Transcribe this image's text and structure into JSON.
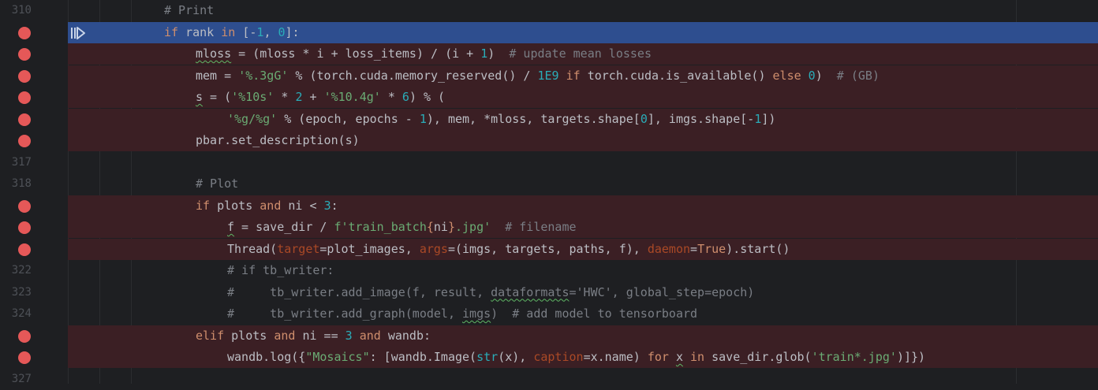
{
  "colors": {
    "background": "#1e1f22",
    "breakpoint_line": "#3b1f24",
    "current_line": "#2e4e8f",
    "breakpoint_dot": "#e55858",
    "keyword": "#cf8e6d",
    "number": "#2aacb8",
    "string": "#6aab73",
    "comment": "#7a7e85",
    "param": "#aa4926"
  },
  "icons": {
    "breakpoint": "breakpoint-icon",
    "execution": "execution-point-icon"
  },
  "lines": [
    {
      "num": "310",
      "indent": 0,
      "tokens": [
        {
          "t": "# Print",
          "c": "com"
        }
      ]
    },
    {
      "num": "",
      "bp": true,
      "current": true,
      "indent": 0,
      "tokens": [
        {
          "t": "if",
          "c": "kw"
        },
        {
          "t": " rank "
        },
        {
          "t": "in",
          "c": "kw"
        },
        {
          "t": " [-"
        },
        {
          "t": "1",
          "c": "num"
        },
        {
          "t": ", "
        },
        {
          "t": "0",
          "c": "num"
        },
        {
          "t": "]:"
        }
      ]
    },
    {
      "num": "",
      "bp": true,
      "indent": 1,
      "tokens": [
        {
          "t": "mloss",
          "w": true
        },
        {
          "t": " = (mloss * i + loss_items) / (i + "
        },
        {
          "t": "1",
          "c": "num"
        },
        {
          "t": ")  "
        },
        {
          "t": "# update mean losses",
          "c": "com"
        }
      ]
    },
    {
      "num": "",
      "bp": true,
      "indent": 1,
      "tokens": [
        {
          "t": "mem = "
        },
        {
          "t": "'%.3gG'",
          "c": "str"
        },
        {
          "t": " % (torch.cuda.memory_reserved() / "
        },
        {
          "t": "1E9",
          "c": "num"
        },
        {
          "t": " "
        },
        {
          "t": "if",
          "c": "kw"
        },
        {
          "t": " torch.cuda.is_available() "
        },
        {
          "t": "else",
          "c": "kw"
        },
        {
          "t": " "
        },
        {
          "t": "0",
          "c": "num"
        },
        {
          "t": ")  "
        },
        {
          "t": "# (GB)",
          "c": "com"
        }
      ]
    },
    {
      "num": "",
      "bp": true,
      "indent": 1,
      "tokens": [
        {
          "t": "s",
          "w": true
        },
        {
          "t": " = ("
        },
        {
          "t": "'%10s'",
          "c": "str"
        },
        {
          "t": " * "
        },
        {
          "t": "2",
          "c": "num"
        },
        {
          "t": " + "
        },
        {
          "t": "'%10.4g'",
          "c": "str"
        },
        {
          "t": " * "
        },
        {
          "t": "6",
          "c": "num"
        },
        {
          "t": ") % ("
        }
      ]
    },
    {
      "num": "",
      "bp": true,
      "indent": 2,
      "tokens": [
        {
          "t": "'%g/%g'",
          "c": "str"
        },
        {
          "t": " % (epoch, epochs - "
        },
        {
          "t": "1",
          "c": "num"
        },
        {
          "t": "), mem, *mloss, targets.shape["
        },
        {
          "t": "0",
          "c": "num"
        },
        {
          "t": "], imgs.shape[-"
        },
        {
          "t": "1",
          "c": "num"
        },
        {
          "t": "])"
        }
      ]
    },
    {
      "num": "",
      "bp": true,
      "indent": 1,
      "tokens": [
        {
          "t": "pbar.set_description(s)"
        }
      ]
    },
    {
      "num": "317",
      "indent": 0,
      "tokens": []
    },
    {
      "num": "318",
      "indent": 1,
      "tokens": [
        {
          "t": "# Plot",
          "c": "com"
        }
      ]
    },
    {
      "num": "",
      "bp": true,
      "indent": 1,
      "tokens": [
        {
          "t": "if",
          "c": "kw"
        },
        {
          "t": " plots "
        },
        {
          "t": "and",
          "c": "kw"
        },
        {
          "t": " ni < "
        },
        {
          "t": "3",
          "c": "num"
        },
        {
          "t": ":"
        }
      ]
    },
    {
      "num": "",
      "bp": true,
      "indent": 2,
      "tokens": [
        {
          "t": "f",
          "w": true
        },
        {
          "t": " = save_dir / "
        },
        {
          "t": "f'train_batch",
          "c": "str"
        },
        {
          "t": "{",
          "c": "kw"
        },
        {
          "t": "ni"
        },
        {
          "t": "}",
          "c": "kw"
        },
        {
          "t": ".jpg'",
          "c": "str"
        },
        {
          "t": "  "
        },
        {
          "t": "# filename",
          "c": "com"
        }
      ]
    },
    {
      "num": "",
      "bp": true,
      "indent": 2,
      "tokens": [
        {
          "t": "Thread("
        },
        {
          "t": "target",
          "c": "param"
        },
        {
          "t": "=plot_images, "
        },
        {
          "t": "args",
          "c": "param"
        },
        {
          "t": "=(imgs, targets, paths, f), "
        },
        {
          "t": "daemon",
          "c": "param"
        },
        {
          "t": "="
        },
        {
          "t": "True",
          "c": "kw"
        },
        {
          "t": ").start()"
        }
      ]
    },
    {
      "num": "322",
      "indent": 2,
      "tokens": [
        {
          "t": "# if tb_writer:",
          "c": "com"
        }
      ]
    },
    {
      "num": "323",
      "indent": 2,
      "tokens": [
        {
          "t": "#     tb_writer.add_image(f, result, ",
          "c": "com"
        },
        {
          "t": "dataformats",
          "c": "com",
          "w": true
        },
        {
          "t": "='HWC', global_step=epoch)",
          "c": "com"
        }
      ]
    },
    {
      "num": "324",
      "indent": 2,
      "tokens": [
        {
          "t": "#     tb_writer.add_graph(model, ",
          "c": "com"
        },
        {
          "t": "imgs",
          "c": "com",
          "w": true
        },
        {
          "t": ")  # add model to tensorboard",
          "c": "com"
        }
      ]
    },
    {
      "num": "",
      "bp": true,
      "indent": 1,
      "tokens": [
        {
          "t": "elif",
          "c": "kw"
        },
        {
          "t": " plots "
        },
        {
          "t": "and",
          "c": "kw"
        },
        {
          "t": " ni == "
        },
        {
          "t": "3",
          "c": "num"
        },
        {
          "t": " "
        },
        {
          "t": "and",
          "c": "kw"
        },
        {
          "t": " wandb:"
        }
      ]
    },
    {
      "num": "",
      "bp": true,
      "indent": 2,
      "tokens": [
        {
          "t": "wandb.log({"
        },
        {
          "t": "\"Mosaics\"",
          "c": "str"
        },
        {
          "t": ": [wandb.Image("
        },
        {
          "t": "str",
          "c": "num"
        },
        {
          "t": "(x), "
        },
        {
          "t": "caption",
          "c": "param"
        },
        {
          "t": "=x.name) "
        },
        {
          "t": "for",
          "c": "kw"
        },
        {
          "t": " "
        },
        {
          "t": "x",
          "w": true
        },
        {
          "t": " "
        },
        {
          "t": "in",
          "c": "kw"
        },
        {
          "t": " save_dir.glob("
        },
        {
          "t": "'train*.jpg'",
          "c": "str"
        },
        {
          "t": ")]})"
        }
      ]
    },
    {
      "num": "327",
      "indent": 0,
      "tokens": []
    }
  ]
}
